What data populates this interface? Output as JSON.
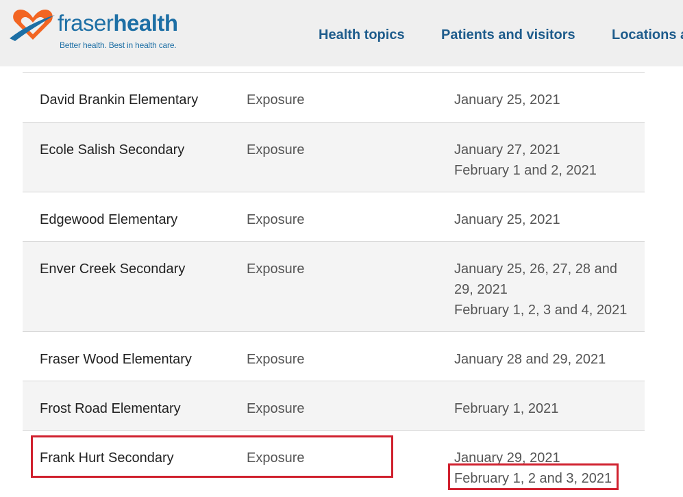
{
  "header": {
    "logo": {
      "word_part1": "fraser",
      "word_part2": "health",
      "tagline": "Better health. Best in health care.",
      "colors": {
        "orange": "#f26522",
        "blue": "#1d6fa5"
      }
    },
    "nav": [
      {
        "label": "Health topics"
      },
      {
        "label": "Patients and visitors"
      },
      {
        "label": "Locations a"
      }
    ]
  },
  "table": {
    "rows": [
      {
        "school": "David Brankin Elementary",
        "type": "Exposure",
        "dates": [
          "January 25, 2021"
        ]
      },
      {
        "school": "Ecole Salish Secondary",
        "type": "Exposure",
        "dates": [
          "January 27, 2021",
          "February 1 and 2, 2021"
        ]
      },
      {
        "school": "Edgewood Elementary",
        "type": "Exposure",
        "dates": [
          "January 25, 2021"
        ]
      },
      {
        "school": "Enver Creek Secondary",
        "type": "Exposure",
        "dates": [
          "January 25, 26, 27, 28 and",
          "29, 2021",
          "February 1, 2, 3 and 4, 2021"
        ]
      },
      {
        "school": "Fraser Wood Elementary",
        "type": "Exposure",
        "dates": [
          "January 28 and 29, 2021"
        ]
      },
      {
        "school": "Frost Road Elementary",
        "type": "Exposure",
        "dates": [
          "February 1, 2021"
        ]
      },
      {
        "school": "Frank Hurt Secondary",
        "type": "Exposure",
        "dates": [
          "January 29, 2021",
          "February 1, 2 and 3, 2021"
        ]
      }
    ]
  },
  "annotations": {
    "highlight_color": "#d0202e"
  }
}
